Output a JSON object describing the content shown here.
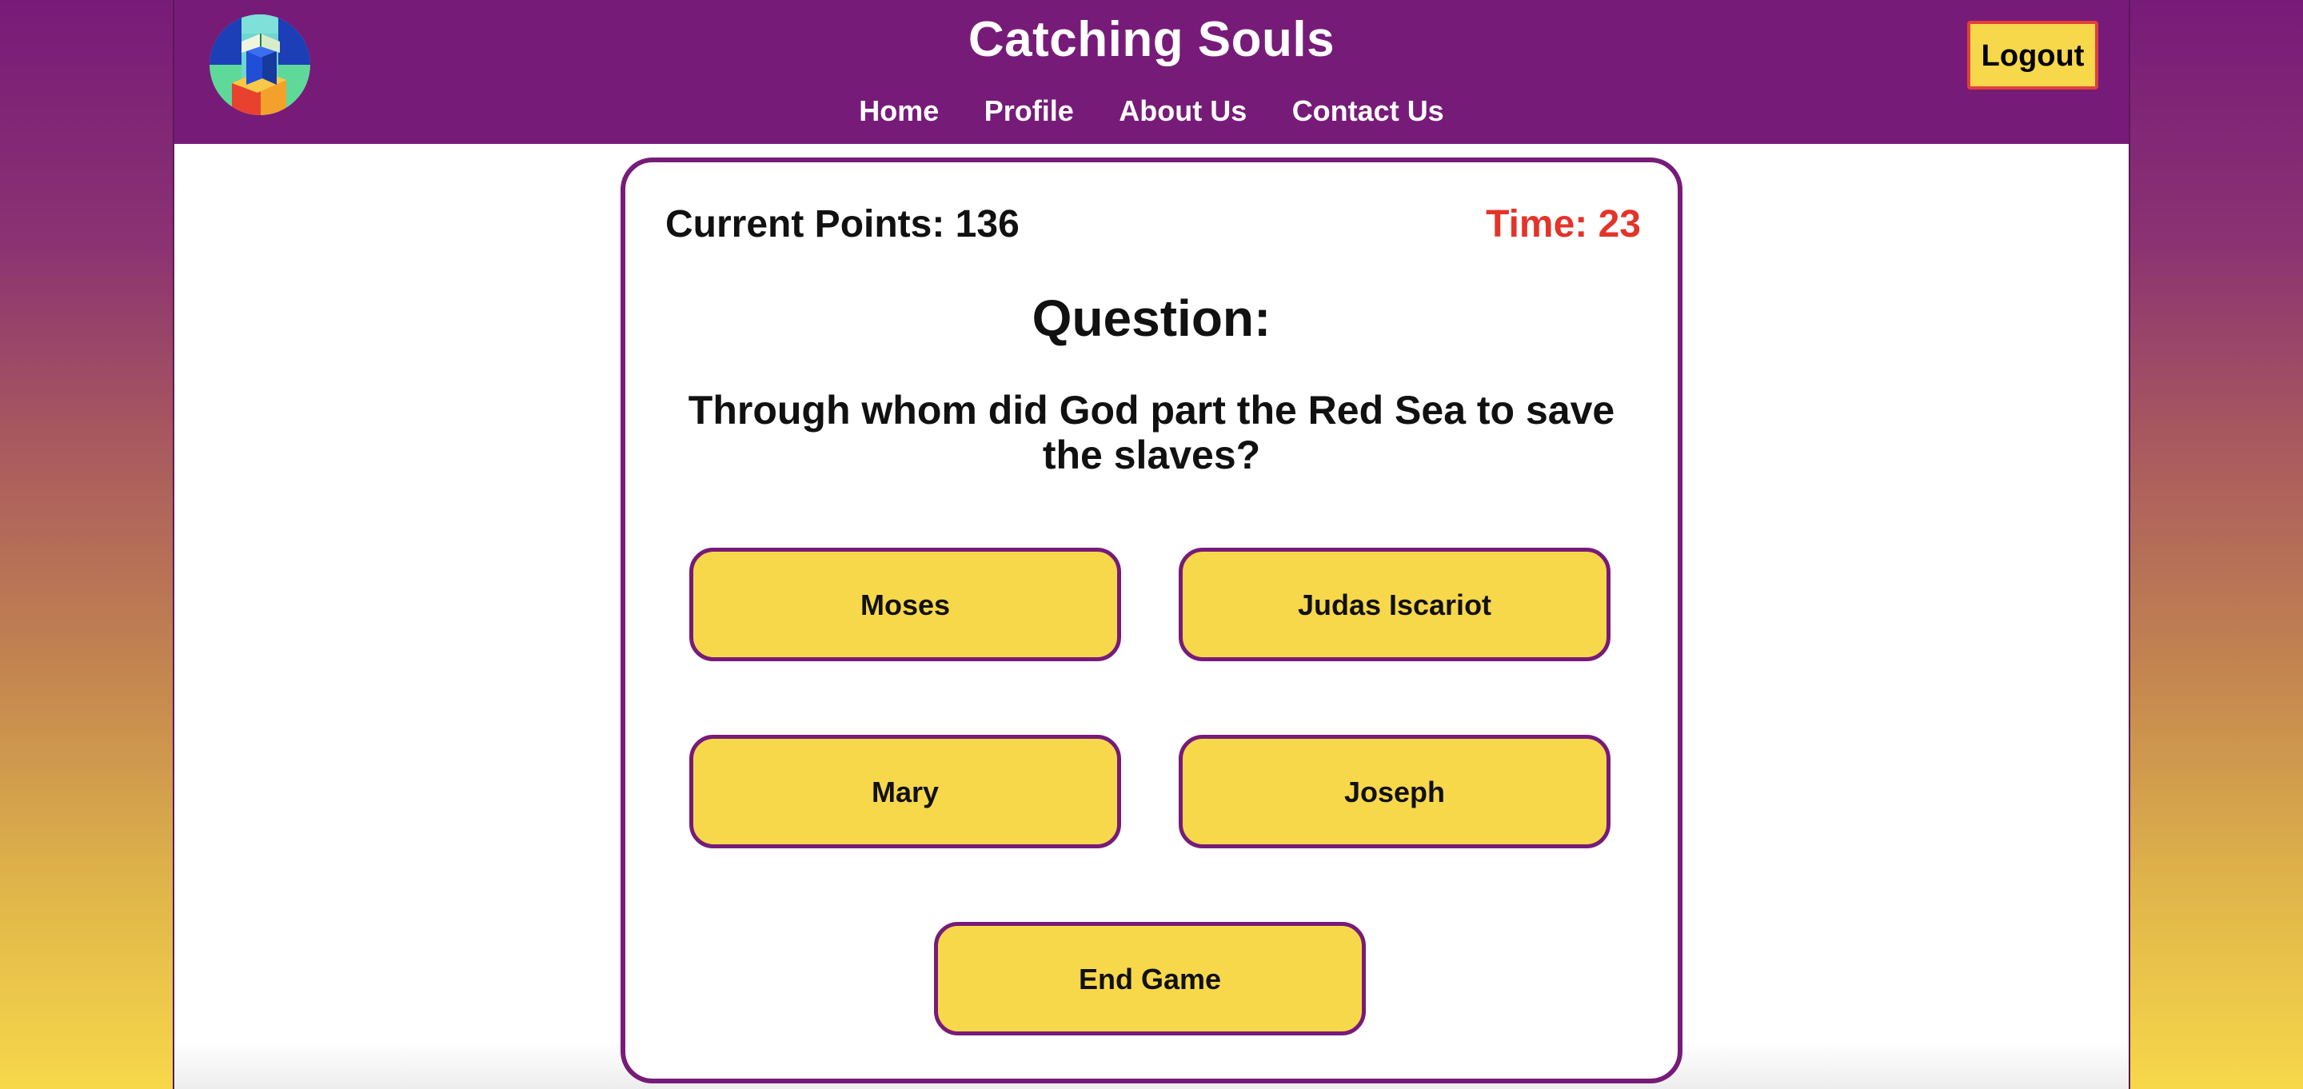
{
  "header": {
    "title": "Catching Souls",
    "nav": [
      "Home",
      "Profile",
      "About Us",
      "Contact Us"
    ],
    "logout_label": "Logout",
    "logo_icon": "stacked-blocks-book-logo"
  },
  "game": {
    "points_label": "Current Points: 136",
    "points": 136,
    "time_label": "Time: 23",
    "time": 23,
    "question_heading": "Question:",
    "question_text": "Through whom did God part the Red Sea to save the slaves?",
    "answers": [
      "Moses",
      "Judas Iscariot",
      "Mary",
      "Joseph"
    ],
    "end_game_label": "End Game"
  },
  "colors": {
    "brand_purple": "#771b79",
    "button_yellow": "#f8d84b",
    "timer_red": "#e3342a",
    "logout_border": "#e0403a"
  }
}
